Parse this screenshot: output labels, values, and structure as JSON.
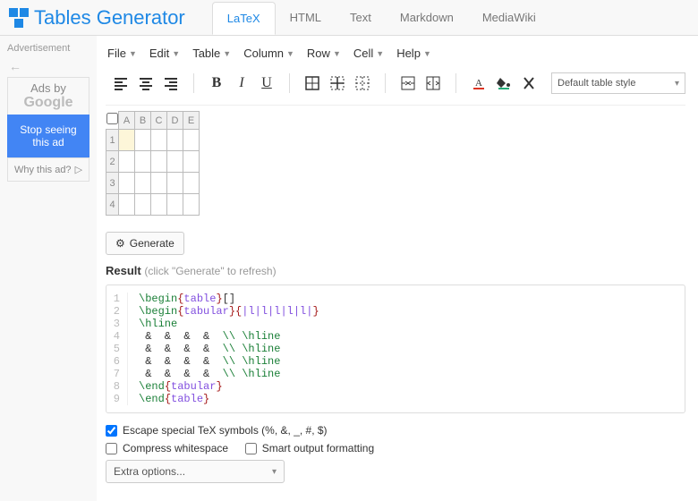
{
  "brand": "Tables Generator",
  "tabs": [
    "LaTeX",
    "HTML",
    "Text",
    "Markdown",
    "MediaWiki"
  ],
  "active_tab": "LaTeX",
  "sidebar": {
    "ad_label": "Advertisement",
    "ads_by_line1": "Ads by",
    "ads_by_line2": "Google",
    "stop_seeing": "Stop seeing this ad",
    "why": "Why this ad?"
  },
  "menu": [
    "File",
    "Edit",
    "Table",
    "Column",
    "Row",
    "Cell",
    "Help"
  ],
  "style_select": "Default table style",
  "grid": {
    "columns": [
      "A",
      "B",
      "C",
      "D",
      "E"
    ],
    "rows": [
      "1",
      "2",
      "3",
      "4"
    ],
    "selected": {
      "row": 0,
      "col": 0
    }
  },
  "generate_btn": "Generate",
  "result_label": "Result",
  "result_hint": "(click \"Generate\" to refresh)",
  "code_lines": [
    [
      {
        "cls": "cmd",
        "t": "\\begin"
      },
      {
        "cls": "brace",
        "t": "{"
      },
      {
        "cls": "arg",
        "t": "table"
      },
      {
        "cls": "brace",
        "t": "}"
      },
      {
        "cls": "",
        "t": "[]"
      }
    ],
    [
      {
        "cls": "cmd",
        "t": "\\begin"
      },
      {
        "cls": "brace",
        "t": "{"
      },
      {
        "cls": "arg",
        "t": "tabular"
      },
      {
        "cls": "brace",
        "t": "}"
      },
      {
        "cls": "brace",
        "t": "{"
      },
      {
        "cls": "arg",
        "t": "|l|l|l|l|l|"
      },
      {
        "cls": "brace",
        "t": "}"
      }
    ],
    [
      {
        "cls": "cmd",
        "t": "\\hline"
      }
    ],
    [
      {
        "cls": "amp",
        "t": " &  &  &  &  "
      },
      {
        "cls": "cmd",
        "t": "\\\\ \\hline"
      }
    ],
    [
      {
        "cls": "amp",
        "t": " &  &  &  &  "
      },
      {
        "cls": "cmd",
        "t": "\\\\ \\hline"
      }
    ],
    [
      {
        "cls": "amp",
        "t": " &  &  &  &  "
      },
      {
        "cls": "cmd",
        "t": "\\\\ \\hline"
      }
    ],
    [
      {
        "cls": "amp",
        "t": " &  &  &  &  "
      },
      {
        "cls": "cmd",
        "t": "\\\\ \\hline"
      }
    ],
    [
      {
        "cls": "cmd",
        "t": "\\end"
      },
      {
        "cls": "brace",
        "t": "{"
      },
      {
        "cls": "arg",
        "t": "tabular"
      },
      {
        "cls": "brace",
        "t": "}"
      }
    ],
    [
      {
        "cls": "cmd",
        "t": "\\end"
      },
      {
        "cls": "brace",
        "t": "{"
      },
      {
        "cls": "arg",
        "t": "table"
      },
      {
        "cls": "brace",
        "t": "}"
      }
    ]
  ],
  "checks": {
    "escape": {
      "label": "Escape special TeX symbols (%, &, _, #, $)",
      "checked": true
    },
    "compress": {
      "label": "Compress whitespace",
      "checked": false
    },
    "smart": {
      "label": "Smart output formatting",
      "checked": false
    }
  },
  "extra_options": "Extra options..."
}
